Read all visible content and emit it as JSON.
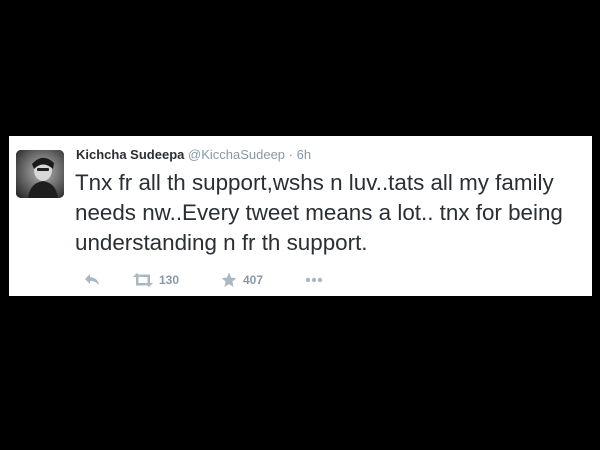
{
  "tweet": {
    "author_name": "Kichcha Sudeepa",
    "handle": "@KicchaSudeep",
    "separator": "·",
    "time": "6h",
    "text": "Tnx fr all th support,wshs n luv..tats all my family needs nw..Every tweet means a lot.. tnx for being understanding n fr th support.",
    "retweet_count": "130",
    "favorite_count": "407"
  },
  "icons": {
    "reply": "reply-icon",
    "retweet": "retweet-icon",
    "favorite": "star-icon",
    "more": "more-icon"
  },
  "colors": {
    "background": "#000000",
    "card": "#ffffff",
    "text": "#292f33",
    "muted": "#8899a6",
    "icon": "#aab8c2"
  }
}
